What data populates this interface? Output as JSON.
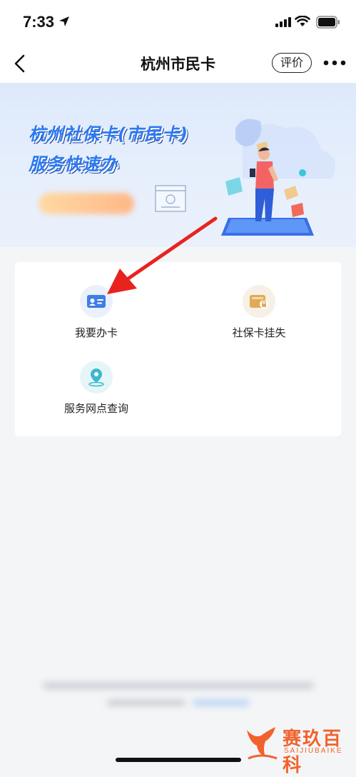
{
  "status_bar": {
    "time": "7:33",
    "icons": [
      "location-arrow-icon",
      "signal-icon",
      "wifi-icon",
      "battery-icon"
    ]
  },
  "nav": {
    "title": "杭州市民卡",
    "rate_label": "评价",
    "icons": [
      "back-chevron-icon",
      "more-icon"
    ]
  },
  "banner": {
    "title_line1": "杭州社保卡(市民卡)",
    "title_line2": "服务快速办",
    "accent_color": "#2b78f0"
  },
  "services": [
    {
      "label": "我要办卡",
      "icon": "id-card-icon",
      "icon_bg": "#eaf1fb",
      "color": "#3e7ee6"
    },
    {
      "label": "社保卡挂失",
      "icon": "wallet-lock-icon",
      "icon_bg": "#f7f0e6",
      "color": "#e2aa55"
    },
    {
      "label": "服务网点查询",
      "icon": "location-pin-icon",
      "icon_bg": "#e6f6f8",
      "color": "#3cb8cf"
    }
  ],
  "annotation": {
    "type": "red-arrow",
    "points_to": "我要办卡",
    "color": "#e8231f"
  },
  "watermark": {
    "text": "赛玖百科",
    "subtext": "SAIJIUBAIKE",
    "color": "#f2622c"
  }
}
